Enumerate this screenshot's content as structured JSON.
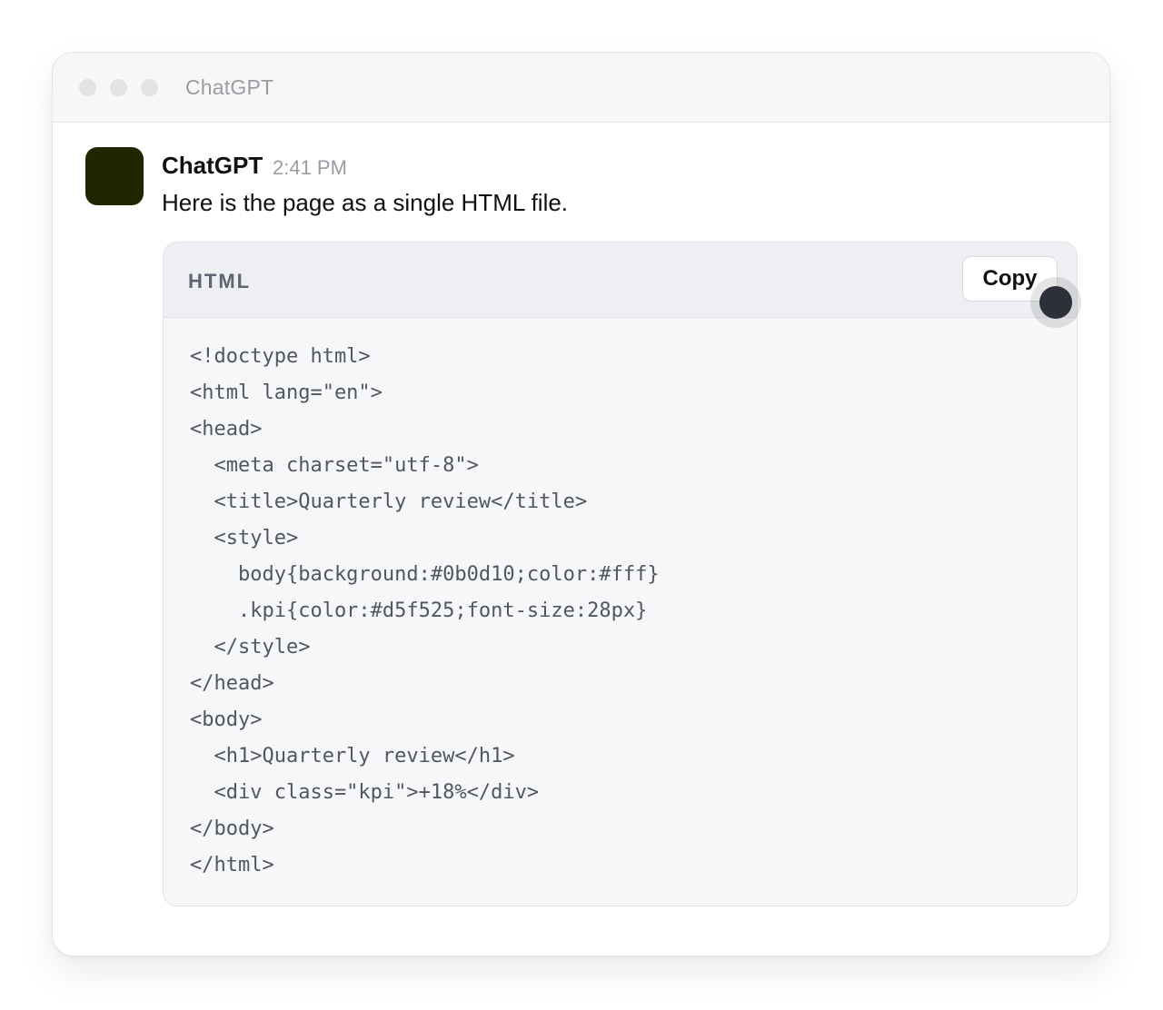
{
  "window": {
    "title": "ChatGPT"
  },
  "message": {
    "author": "ChatGPT",
    "time": "2:41 PM",
    "text": "Here is the page as a single HTML file."
  },
  "code_block": {
    "language": "HTML",
    "copy_label": "Copy",
    "lines": [
      "<!doctype html>",
      "<html lang=\"en\">",
      "<head>",
      "  <meta charset=\"utf-8\">",
      "  <title>Quarterly review</title>",
      "  <style>",
      "    body{background:#0b0d10;color:#fff}",
      "    .kpi{color:#d5f525;font-size:28px}",
      "  </style>",
      "</head>",
      "<body>",
      "  <h1>Quarterly review</h1>",
      "  <div class=\"kpi\">+18%</div>",
      "</body>",
      "</html>"
    ]
  },
  "colors": {
    "avatar": "#222600",
    "code_background": "#f6f7f9",
    "code_header": "#eeeff2",
    "cursor": "#2d3038"
  },
  "icons": {
    "window_controls": [
      "window-dot-icon",
      "window-dot-icon",
      "window-dot-icon"
    ],
    "cursor": "cursor-icon"
  }
}
